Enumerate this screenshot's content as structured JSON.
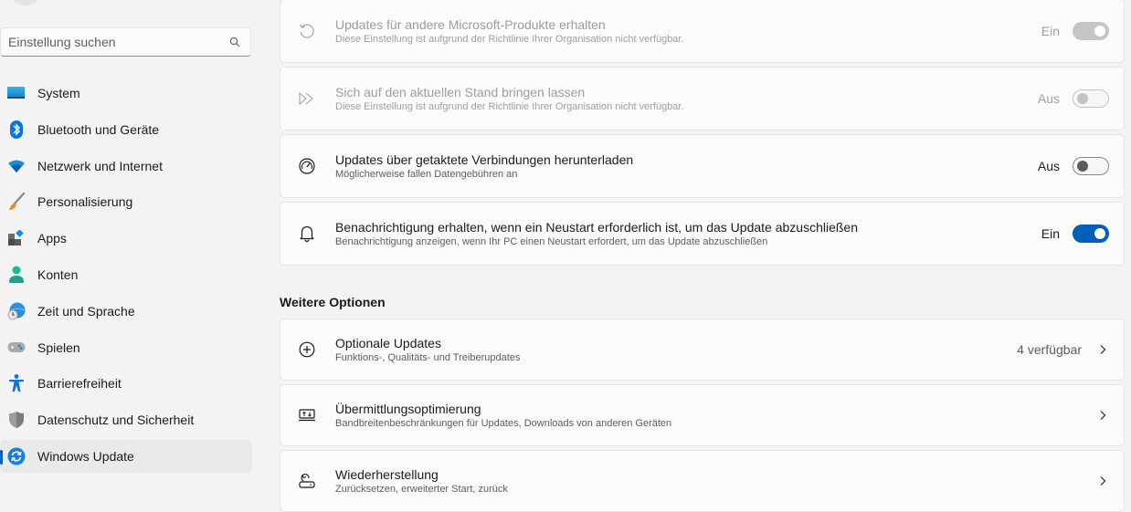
{
  "sidebar": {
    "search": {
      "placeholder": "Einstellung suchen",
      "icon": "search-icon"
    },
    "items": [
      {
        "label": "System",
        "icon": "system-monitor-icon"
      },
      {
        "label": "Bluetooth und Geräte",
        "icon": "bluetooth-icon"
      },
      {
        "label": "Netzwerk und Internet",
        "icon": "wifi-icon"
      },
      {
        "label": "Personalisierung",
        "icon": "paintbrush-icon"
      },
      {
        "label": "Apps",
        "icon": "apps-icon"
      },
      {
        "label": "Konten",
        "icon": "account-icon"
      },
      {
        "label": "Zeit und Sprache",
        "icon": "globe-clock-icon"
      },
      {
        "label": "Spielen",
        "icon": "gamepad-icon"
      },
      {
        "label": "Barrierefreiheit",
        "icon": "accessibility-icon"
      },
      {
        "label": "Datenschutz und Sicherheit",
        "icon": "shield-icon"
      },
      {
        "label": "Windows Update",
        "icon": "windows-update-icon",
        "active": true
      }
    ]
  },
  "main": {
    "settings": [
      {
        "title": "Updates für andere Microsoft-Produkte erhalten",
        "subtitle": "Diese Einstellung ist aufgrund der Richtlinie Ihrer Organisation nicht verfügbar.",
        "state_label": "Ein",
        "on": true,
        "disabled": true,
        "icon": "history-icon"
      },
      {
        "title": "Sich auf den aktuellen Stand bringen lassen",
        "subtitle": "Diese Einstellung ist aufgrund der Richtlinie Ihrer Organisation nicht verfügbar.",
        "state_label": "Aus",
        "on": false,
        "disabled": true,
        "icon": "fast-forward-icon"
      },
      {
        "title": "Updates über getaktete Verbindungen herunterladen",
        "subtitle": "Möglicherweise fallen Datengebühren an",
        "state_label": "Aus",
        "on": false,
        "disabled": false,
        "icon": "speedometer-icon"
      },
      {
        "title": "Benachrichtigung erhalten, wenn ein Neustart erforderlich ist, um das Update abzuschließen",
        "subtitle": "Benachrichtigung anzeigen, wenn Ihr PC einen Neustart erfordert, um das Update abzuschließen",
        "state_label": "Ein",
        "on": true,
        "disabled": false,
        "icon": "bell-icon"
      }
    ],
    "more_options": {
      "heading": "Weitere Optionen",
      "items": [
        {
          "title": "Optionale Updates",
          "subtitle": "Funktions-, Qualitäts- und Treiberupdates",
          "badge": "4 verfügbar",
          "icon": "plus-circle-icon"
        },
        {
          "title": "Übermittlungsoptimierung",
          "subtitle": "Bandbreitenbeschränkungen für Updates, Downloads von anderen Geräten",
          "icon": "delivery-optimization-icon"
        },
        {
          "title": "Wiederherstellung",
          "subtitle": "Zurücksetzen, erweiterter Start, zurück",
          "icon": "recovery-icon"
        }
      ]
    }
  },
  "colors": {
    "accent": "#005fb8",
    "background": "#f3f3f3",
    "card": "#fbfbfb"
  }
}
